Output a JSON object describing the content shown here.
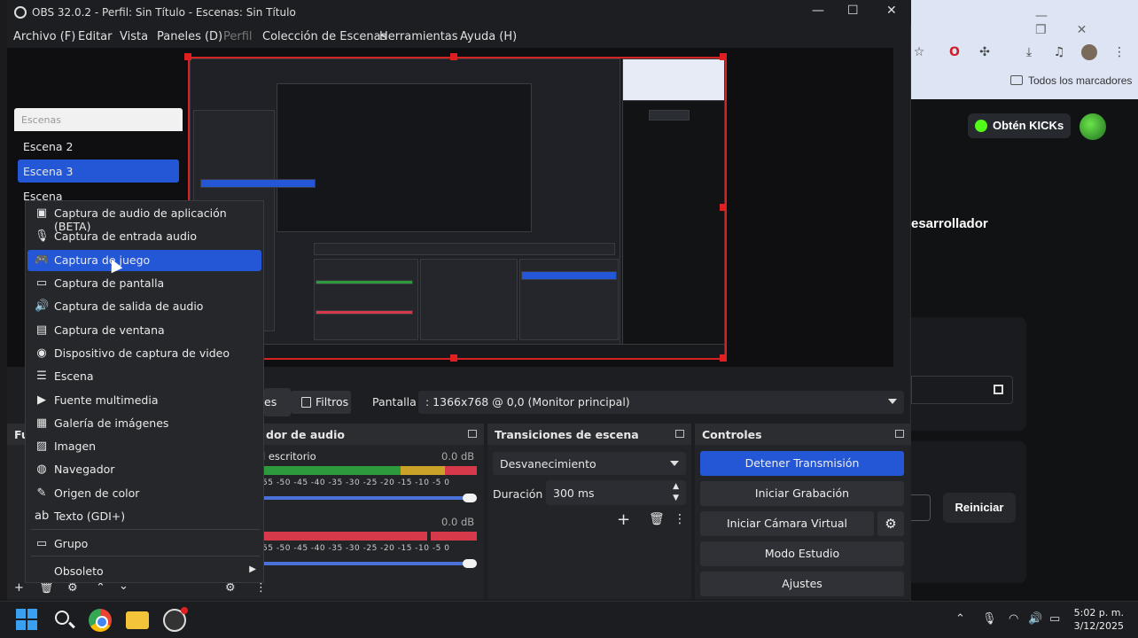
{
  "window": {
    "title": "OBS 32.0.2 - Perfil: Sin Título - Escenas: Sin Título",
    "minimize": "—",
    "maximize": "☐",
    "close": "✕"
  },
  "menu": {
    "archivo": "Archivo (F)",
    "editar": "Editar",
    "vista": "Vista",
    "paneles": "Paneles (D)",
    "perfil": "Perfil",
    "coleccion": "Colección de Escenas",
    "herramientas": "Herramientas",
    "ayuda": "Ayuda (H)"
  },
  "scenes": {
    "header": "Escenas",
    "items": [
      "Escena 2",
      "Escena 3",
      "Escena"
    ],
    "selected": "Escena 3"
  },
  "context_menu": {
    "items": [
      {
        "label": "Captura de audio de aplicación (BETA)",
        "icon": "app-audio-icon"
      },
      {
        "label": "Captura de entrada audio",
        "icon": "microphone-icon"
      },
      {
        "label": "Captura de juego",
        "icon": "gamepad-icon",
        "selected": true
      },
      {
        "label": "Captura de pantalla",
        "icon": "monitor-icon"
      },
      {
        "label": "Captura de salida de audio",
        "icon": "speaker-icon"
      },
      {
        "label": "Captura de ventana",
        "icon": "window-icon"
      },
      {
        "label": "Dispositivo de captura de video",
        "icon": "camera-icon"
      },
      {
        "label": "Escena",
        "icon": "list-icon"
      },
      {
        "label": "Fuente multimedia",
        "icon": "play-icon"
      },
      {
        "label": "Galería de imágenes",
        "icon": "gallery-icon"
      },
      {
        "label": "Imagen",
        "icon": "image-icon"
      },
      {
        "label": "Navegador",
        "icon": "globe-icon"
      },
      {
        "label": "Origen de color",
        "icon": "brush-icon"
      },
      {
        "label": "Texto (GDI+)",
        "icon": "text-icon"
      },
      {
        "label": "Grupo",
        "icon": "folder-icon"
      },
      {
        "label": "Obsoleto",
        "icon": ""
      }
    ]
  },
  "source_bar": {
    "ses_fragment": "es",
    "filtros": "Filtros",
    "pantalla_label": "Pantalla",
    "pantalla_value": ": 1366x768 @ 0,0 (Monitor principal)"
  },
  "audio_mixer": {
    "header": "dor de audio",
    "track1_name": "l escritorio",
    "track1_db": "0.0 dB",
    "track2_db": "0.0 dB",
    "ticks": "55 -50 -45 -40 -35 -30 -25 -20 -15 -10 -5 0"
  },
  "transitions": {
    "header": "Transiciones de escena",
    "selected": "Desvanecimiento",
    "duration_label": "Duración",
    "duration_value": "300 ms"
  },
  "controls": {
    "header": "Controles",
    "stop_stream": "Detener Transmisión",
    "start_recording": "Iniciar Grabación",
    "virtual_cam": "Iniciar Cámara Virtual",
    "studio_mode": "Modo Estudio",
    "settings": "Ajustes"
  },
  "browser": {
    "bookmarks": "Todos los marcadores",
    "kick_button": "Obtén KICKs",
    "dev_text": "esarrollador",
    "reiniciar": "Reiniciar"
  },
  "taskbar": {
    "time": "5:02 p. m.",
    "date": "3/12/2025"
  },
  "colors": {
    "accent": "#2457d6",
    "preview_border": "#d42323",
    "meter_green": "#2e9a3e",
    "meter_yellow": "#c9a227",
    "meter_red": "#d63a4a"
  }
}
